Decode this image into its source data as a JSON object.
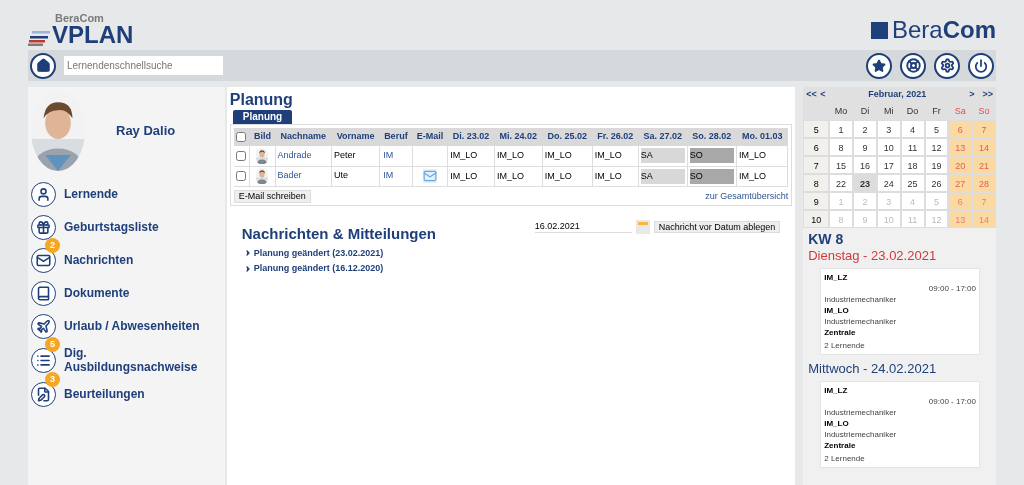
{
  "header": {
    "brand_small": "BeraCom",
    "brand_large": "VPLAN",
    "corner_logo": {
      "part1": "Bera",
      "part2": "Com"
    }
  },
  "toolbar": {
    "search": {
      "placeholder": "Lernendenschnellsuche"
    }
  },
  "profile": {
    "name": "Ray Dalio"
  },
  "nav": [
    {
      "label": "Lernende"
    },
    {
      "label": "Geburtstagsliste"
    },
    {
      "label": "Nachrichten",
      "badge": "2"
    },
    {
      "label": "Dokumente"
    },
    {
      "label": "Urlaub / Abwesenheiten"
    },
    {
      "label": "Dig. Ausbildungsnachweise",
      "badge": "5"
    },
    {
      "label": "Beurteilungen",
      "badge": "3"
    }
  ],
  "planning": {
    "title": "Planung",
    "tabs": [
      {
        "label": "Planung",
        "selected": true
      }
    ],
    "columns": [
      "Bild",
      "Nachname",
      "Vorname",
      "Beruf",
      "E-Mail",
      "Di. 23.02",
      "Mi. 24.02",
      "Do. 25.02",
      "Fr. 26.02",
      "Sa. 27.02",
      "So. 28.02",
      "Mo. 01.03"
    ],
    "header_checked": false,
    "rows": [
      {
        "checked": false,
        "nachname": "Andrade",
        "vorname": "Peter",
        "beruf": "IM",
        "has_email": false,
        "days": [
          {
            "text": "IM_LO",
            "kind": "work"
          },
          {
            "text": "IM_LO",
            "kind": "work"
          },
          {
            "text": "IM_LO",
            "kind": "work"
          },
          {
            "text": "IM_LO",
            "kind": "work"
          },
          {
            "text": "SA",
            "kind": "sa"
          },
          {
            "text": "SO",
            "kind": "so"
          },
          {
            "text": "IM_LO",
            "kind": "work"
          }
        ]
      },
      {
        "checked": false,
        "nachname": "Bader",
        "vorname": "Ute",
        "beruf": "IM",
        "has_email": true,
        "days": [
          {
            "text": "IM_LO",
            "kind": "work"
          },
          {
            "text": "IM_LO",
            "kind": "work"
          },
          {
            "text": "IM_LO",
            "kind": "work"
          },
          {
            "text": "IM_LO",
            "kind": "work"
          },
          {
            "text": "SA",
            "kind": "sa"
          },
          {
            "text": "SO",
            "kind": "so"
          },
          {
            "text": "IM_LO",
            "kind": "work"
          }
        ]
      }
    ],
    "email_button": "E-Mail schreiben",
    "overview_link": "zur Gesamtübersicht"
  },
  "news": {
    "title": "Nachrichten & Mitteilungen",
    "date": "16.02.2021",
    "archive_button": "Nachricht vor Datum ablegen",
    "items": [
      {
        "label": "Planung geändert (23.02.2021)",
        "expanded": false
      },
      {
        "label": "Planung geändert (16.12.2020)",
        "expanded": false
      }
    ]
  },
  "calendar": {
    "prev_year": "<<",
    "prev_month": "<",
    "month": "Februar, 2021",
    "next_month": ">",
    "next_year": ">>",
    "weekdays": [
      {
        "label": "Mo",
        "weekend": false
      },
      {
        "label": "Di",
        "weekend": false
      },
      {
        "label": "Mi",
        "weekend": false
      },
      {
        "label": "Do",
        "weekend": false
      },
      {
        "label": "Fr",
        "weekend": false
      },
      {
        "label": "Sa",
        "weekend": true
      },
      {
        "label": "So",
        "weekend": true
      }
    ],
    "weeks": [
      {
        "number": "5",
        "days": [
          {
            "label": "1",
            "other": false,
            "selected": false
          },
          {
            "label": "2",
            "other": false,
            "selected": false
          },
          {
            "label": "3",
            "other": false,
            "selected": false
          },
          {
            "label": "4",
            "other": false,
            "selected": false
          },
          {
            "label": "5",
            "other": false,
            "selected": false
          },
          {
            "label": "6",
            "other": false,
            "selected": false
          },
          {
            "label": "7",
            "other": false,
            "selected": false
          }
        ]
      },
      {
        "number": "6",
        "days": [
          {
            "label": "8",
            "other": false,
            "selected": false
          },
          {
            "label": "9",
            "other": false,
            "selected": false
          },
          {
            "label": "10",
            "other": false,
            "selected": false
          },
          {
            "label": "11",
            "other": false,
            "selected": false
          },
          {
            "label": "12",
            "other": false,
            "selected": false
          },
          {
            "label": "13",
            "other": false,
            "selected": false
          },
          {
            "label": "14",
            "other": false,
            "selected": false
          }
        ]
      },
      {
        "number": "7",
        "days": [
          {
            "label": "15",
            "other": false,
            "selected": false
          },
          {
            "label": "16",
            "other": false,
            "selected": false
          },
          {
            "label": "17",
            "other": false,
            "selected": false
          },
          {
            "label": "18",
            "other": false,
            "selected": false
          },
          {
            "label": "19",
            "other": false,
            "selected": false
          },
          {
            "label": "20",
            "other": false,
            "selected": false
          },
          {
            "label": "21",
            "other": false,
            "selected": false
          }
        ]
      },
      {
        "number": "8",
        "days": [
          {
            "label": "22",
            "other": false,
            "selected": false
          },
          {
            "label": "23",
            "other": false,
            "selected": true
          },
          {
            "label": "24",
            "other": false,
            "selected": false
          },
          {
            "label": "25",
            "other": false,
            "selected": false
          },
          {
            "label": "26",
            "other": false,
            "selected": false
          },
          {
            "label": "27",
            "other": false,
            "selected": false
          },
          {
            "label": "28",
            "other": false,
            "selected": false
          }
        ]
      },
      {
        "number": "9",
        "days": [
          {
            "label": "1",
            "other": true,
            "selected": false
          },
          {
            "label": "2",
            "other": true,
            "selected": false
          },
          {
            "label": "3",
            "other": true,
            "selected": false
          },
          {
            "label": "4",
            "other": true,
            "selected": false
          },
          {
            "label": "5",
            "other": true,
            "selected": false
          },
          {
            "label": "6",
            "other": true,
            "selected": false
          },
          {
            "label": "7",
            "other": true,
            "selected": false
          }
        ]
      },
      {
        "number": "10",
        "days": [
          {
            "label": "8",
            "other": true,
            "selected": false
          },
          {
            "label": "9",
            "other": true,
            "selected": false
          },
          {
            "label": "10",
            "other": true,
            "selected": false
          },
          {
            "label": "11",
            "other": true,
            "selected": false
          },
          {
            "label": "12",
            "other": true,
            "selected": false
          },
          {
            "label": "13",
            "other": true,
            "selected": false
          },
          {
            "label": "14",
            "other": true,
            "selected": false
          }
        ]
      }
    ]
  },
  "agenda": {
    "week": "KW 8",
    "days": [
      {
        "title": "Dienstag - 23.02.2021",
        "today": true,
        "entries": [
          {
            "code": "IM_LZ",
            "time": "09:00 - 17:00",
            "job": "Industriemechaniker",
            "code2": "IM_LO",
            "job2": "Industriemechaniker",
            "site": "Zentrale",
            "count": "2 Lernende"
          }
        ]
      },
      {
        "title": "Mittwoch - 24.02.2021",
        "today": false,
        "entries": [
          {
            "code": "IM_LZ",
            "time": "09:00 - 17:00",
            "job": "Industriemechaniker",
            "code2": "IM_LO",
            "job2": "Industriemechaniker",
            "site": "Zentrale",
            "count": "2 Lernende"
          }
        ]
      }
    ]
  }
}
